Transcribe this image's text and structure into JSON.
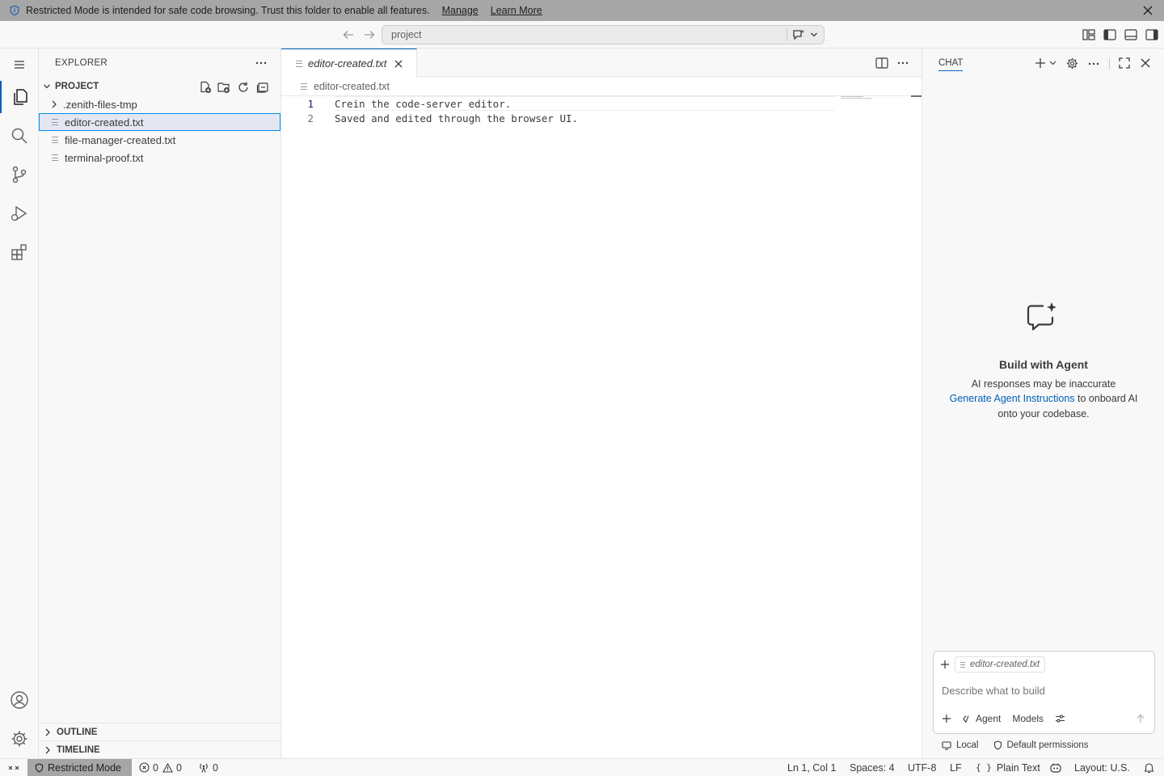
{
  "banner": {
    "message": "Restricted Mode is intended for safe code browsing. Trust this folder to enable all features.",
    "manage_label": "Manage",
    "learn_more_label": "Learn More"
  },
  "titlebar": {
    "search_text": "project"
  },
  "explorer": {
    "title": "EXPLORER",
    "project_label": "PROJECT",
    "items": [
      {
        "label": ".zenith-files-tmp",
        "type": "folder"
      },
      {
        "label": "editor-created.txt",
        "type": "file",
        "selected": true
      },
      {
        "label": "file-manager-created.txt",
        "type": "file"
      },
      {
        "label": "terminal-proof.txt",
        "type": "file"
      }
    ],
    "outline_label": "OUTLINE",
    "timeline_label": "TIMELINE"
  },
  "editor": {
    "tab_label": "editor-created.txt",
    "breadcrumb": "editor-created.txt",
    "lines": [
      {
        "num": "1",
        "text": "Crein the code-server editor."
      },
      {
        "num": "2",
        "text": "Saved and edited through the browser UI."
      }
    ]
  },
  "chat": {
    "title": "CHAT",
    "heading": "Build with Agent",
    "line1": "AI responses may be inaccurate",
    "link": "Generate Agent Instructions",
    "line2_suffix": " to onboard AI",
    "line3": "onto your codebase.",
    "attachment": "editor-created.txt",
    "input_placeholder": "Describe what to build",
    "agent_label": "Agent",
    "models_label": "Models",
    "local_label": "Local",
    "permissions_label": "Default permissions"
  },
  "status": {
    "restricted": "Restricted Mode",
    "errors": "0",
    "warnings": "0",
    "ports": "0",
    "position": "Ln 1, Col 1",
    "spaces": "Spaces: 4",
    "encoding": "UTF-8",
    "eol": "LF",
    "language": "Plain Text",
    "layout": "Layout: U.S."
  },
  "colors": {
    "accent": "#005fb8",
    "banner_bg": "#a6a6a6",
    "selection_border": "#0090f1",
    "restricted_bg": "#a6a6a6"
  }
}
